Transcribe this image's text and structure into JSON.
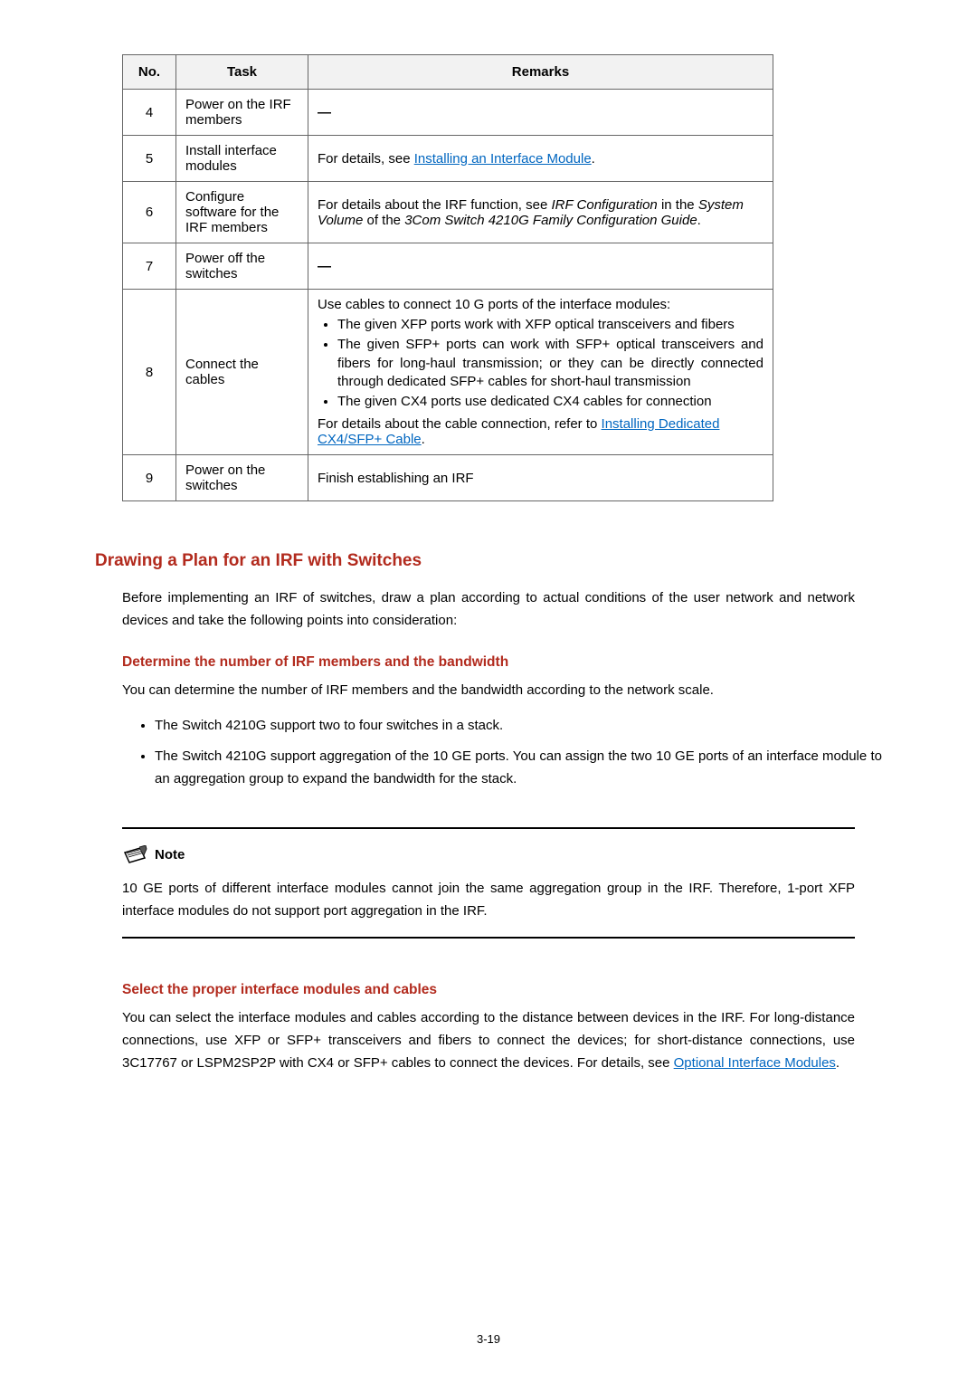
{
  "table": {
    "headers": {
      "no": "No.",
      "task": "Task",
      "remarks": "Remarks"
    },
    "rows": [
      {
        "no": "4",
        "task": "Power on the IRF members",
        "remarks_plain": "—"
      },
      {
        "no": "5",
        "task": "Install interface modules",
        "remarks_prefix": "For details, see ",
        "remarks_link": "Installing an Interface Module",
        "remarks_suffix": "."
      },
      {
        "no": "6",
        "task": "Configure software for the IRF members",
        "remarks_parts": {
          "a": "For details about the IRF function, see ",
          "b": "IRF Configuration",
          "c": " in the ",
          "d": "System Volume",
          "e": " of the ",
          "f": "3Com Switch 4210G Family Configuration Guide",
          "g": "."
        }
      },
      {
        "no": "7",
        "task": "Power off the switches",
        "remarks_plain": "—"
      },
      {
        "no": "8",
        "task": "Connect the cables",
        "remarks8": {
          "intro": "Use cables to connect 10 G ports of the interface modules:",
          "li1": "The given XFP ports work with XFP optical transceivers and fibers",
          "li2": "The given SFP+ ports can work with SFP+ optical transceivers and fibers for long-haul transmission; or they can be directly connected through dedicated SFP+ cables for short-haul transmission",
          "li3": "The given CX4 ports use dedicated CX4 cables for connection",
          "tail_prefix": "For details about the cable connection, refer to ",
          "tail_link": "Installing Dedicated CX4/SFP+ Cable",
          "tail_suffix": "."
        }
      },
      {
        "no": "9",
        "task": "Power on the switches",
        "remarks_plain": "Finish establishing an IRF"
      }
    ]
  },
  "section1_title": "Drawing a Plan for an IRF with Switches",
  "section1_intro": "Before implementing an IRF of switches, draw a plan according to actual conditions of the user network and network devices and take the following points into consideration:",
  "sub1_title": "Determine the number of IRF members and the bandwidth",
  "sub1_p": "You can determine the number of IRF members and the bandwidth according to the network scale.",
  "sub1_li1": "The Switch 4210G support two to four switches in a stack.",
  "sub1_li2": "The Switch 4210G support aggregation of the 10 GE ports. You can assign the two 10 GE ports of an interface module to an aggregation group to expand the bandwidth for the stack.",
  "note_label": "Note",
  "note_body": "10 GE ports of different interface modules cannot join the same aggregation group in the IRF. Therefore, 1-port XFP interface modules do not support port aggregation in the IRF.",
  "sub2_title": "Select the proper interface modules and cables",
  "sub2_p_prefix": "You can select the interface modules and cables according to the distance between devices in the IRF. For long-distance connections, use XFP or SFP+ transceivers and fibers to connect the devices; for short-distance connections, use 3C17767 or LSPM2SP2P with CX4 or SFP+ cables to connect the devices. For details, see ",
  "sub2_link": "Optional Interface Modules",
  "sub2_suffix": ".",
  "page_number": "3-19"
}
